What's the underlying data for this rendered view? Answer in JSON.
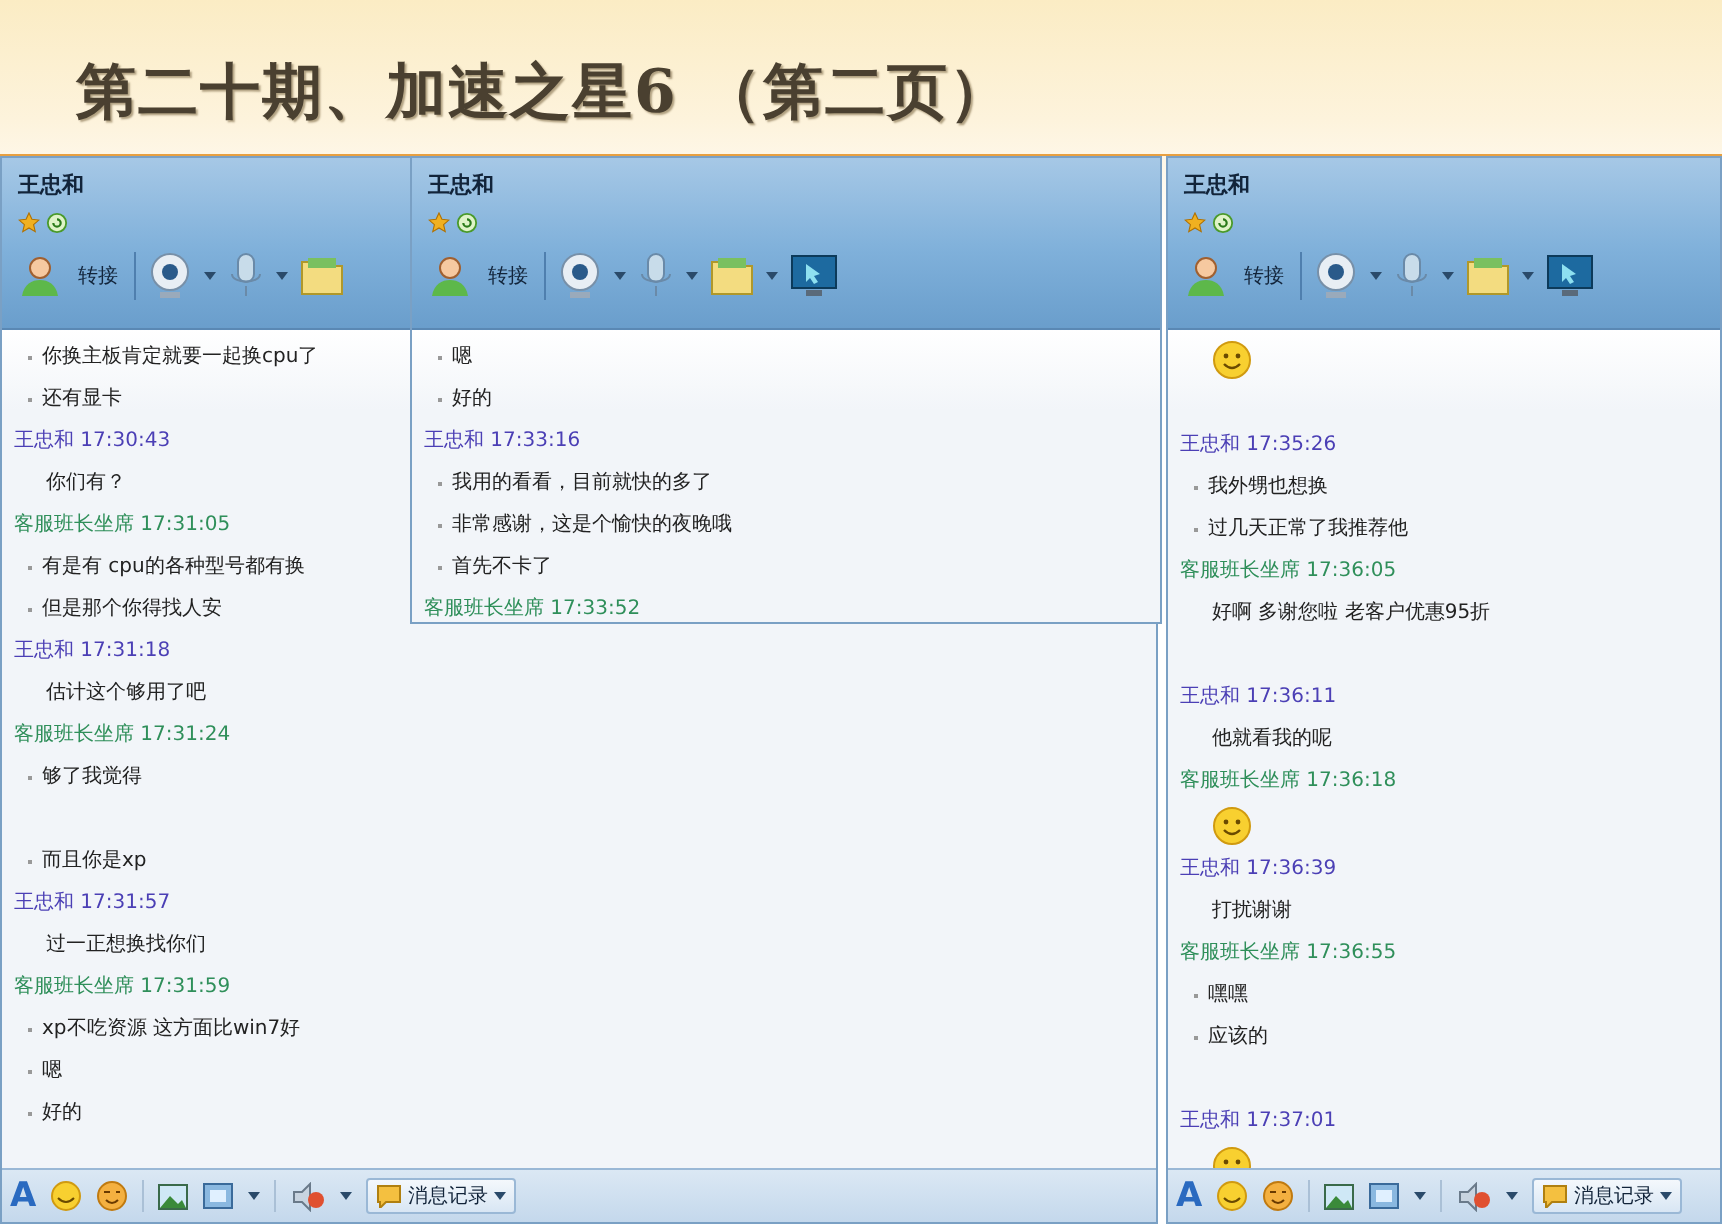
{
  "slide_title": "第二十期、加速之星6 （第二页）",
  "windows": [
    {
      "title": "王忠和",
      "transfer_label": "转接",
      "history_button": "消息记录",
      "format_button": "A",
      "messages": [
        {
          "kind": "bullet",
          "text": "你换主板肯定就要一起换cpu了"
        },
        {
          "kind": "bullet",
          "text": "还有显卡"
        },
        {
          "kind": "header",
          "sender": "王忠和",
          "time": "17:30:43",
          "color": "#4b3fb5"
        },
        {
          "kind": "text",
          "text": "你们有？"
        },
        {
          "kind": "header",
          "sender": "客服班长坐席",
          "time": "17:31:05",
          "color": "#2f8f5a"
        },
        {
          "kind": "bullet",
          "text": "有是有 cpu的各种型号都有换"
        },
        {
          "kind": "bullet",
          "text": "但是那个你得找人安"
        },
        {
          "kind": "header",
          "sender": "王忠和",
          "time": "17:31:18",
          "color": "#4b3fb5"
        },
        {
          "kind": "text",
          "text": "估计这个够用了吧"
        },
        {
          "kind": "header",
          "sender": "客服班长坐席",
          "time": "17:31:24",
          "color": "#2f8f5a"
        },
        {
          "kind": "bullet",
          "text": "够了我觉得"
        },
        {
          "kind": "gap"
        },
        {
          "kind": "bullet",
          "text": "而且你是xp"
        },
        {
          "kind": "header",
          "sender": "王忠和",
          "time": "17:31:57",
          "color": "#4b3fb5"
        },
        {
          "kind": "text",
          "text": "过一正想换找你们"
        },
        {
          "kind": "header",
          "sender": "客服班长坐席",
          "time": "17:31:59",
          "color": "#2f8f5a"
        },
        {
          "kind": "bullet",
          "text": "xp不吃资源 这方面比win7好"
        },
        {
          "kind": "bullet",
          "text": "嗯"
        },
        {
          "kind": "bullet",
          "text": "好的"
        }
      ]
    },
    {
      "title": "王忠和",
      "transfer_label": "转接",
      "messages": [
        {
          "kind": "bullet",
          "text": "嗯"
        },
        {
          "kind": "bullet",
          "text": "好的"
        },
        {
          "kind": "header",
          "sender": "王忠和",
          "time": "17:33:16",
          "color": "#4b3fb5"
        },
        {
          "kind": "bullet",
          "text": "我用的看看，目前就快的多了"
        },
        {
          "kind": "bullet",
          "text": "非常感谢，这是个愉快的夜晚哦"
        },
        {
          "kind": "bullet",
          "text": "首先不卡了"
        },
        {
          "kind": "header",
          "sender": "客服班长坐席",
          "time": "17:33:52",
          "color": "#2f8f5a"
        }
      ]
    },
    {
      "title": "王忠和",
      "transfer_label": "转接",
      "history_button": "消息记录",
      "format_button": "A",
      "messages": [
        {
          "kind": "emoji"
        },
        {
          "kind": "gap"
        },
        {
          "kind": "header",
          "sender": "王忠和",
          "time": "17:35:26",
          "color": "#4b3fb5"
        },
        {
          "kind": "bullet",
          "text": "我外甥也想换"
        },
        {
          "kind": "bullet",
          "text": "过几天正常了我推荐他"
        },
        {
          "kind": "header",
          "sender": "客服班长坐席",
          "time": "17:36:05",
          "color": "#2f8f5a"
        },
        {
          "kind": "text",
          "text": "好啊 多谢您啦 老客户优惠95折"
        },
        {
          "kind": "gap"
        },
        {
          "kind": "header",
          "sender": "王忠和",
          "time": "17:36:11",
          "color": "#4b3fb5"
        },
        {
          "kind": "text",
          "text": "他就看我的呢"
        },
        {
          "kind": "header",
          "sender": "客服班长坐席",
          "time": "17:36:18",
          "color": "#2f8f5a"
        },
        {
          "kind": "emoji"
        },
        {
          "kind": "header",
          "sender": "王忠和",
          "time": "17:36:39",
          "color": "#4b3fb5"
        },
        {
          "kind": "text",
          "text": "打扰谢谢"
        },
        {
          "kind": "header",
          "sender": "客服班长坐席",
          "time": "17:36:55",
          "color": "#2f8f5a"
        },
        {
          "kind": "bullet",
          "text": "嘿嘿"
        },
        {
          "kind": "bullet",
          "text": "应该的"
        },
        {
          "kind": "gap"
        },
        {
          "kind": "header",
          "sender": "王忠和",
          "time": "17:37:01",
          "color": "#4b3fb5"
        },
        {
          "kind": "emoji"
        }
      ]
    }
  ]
}
